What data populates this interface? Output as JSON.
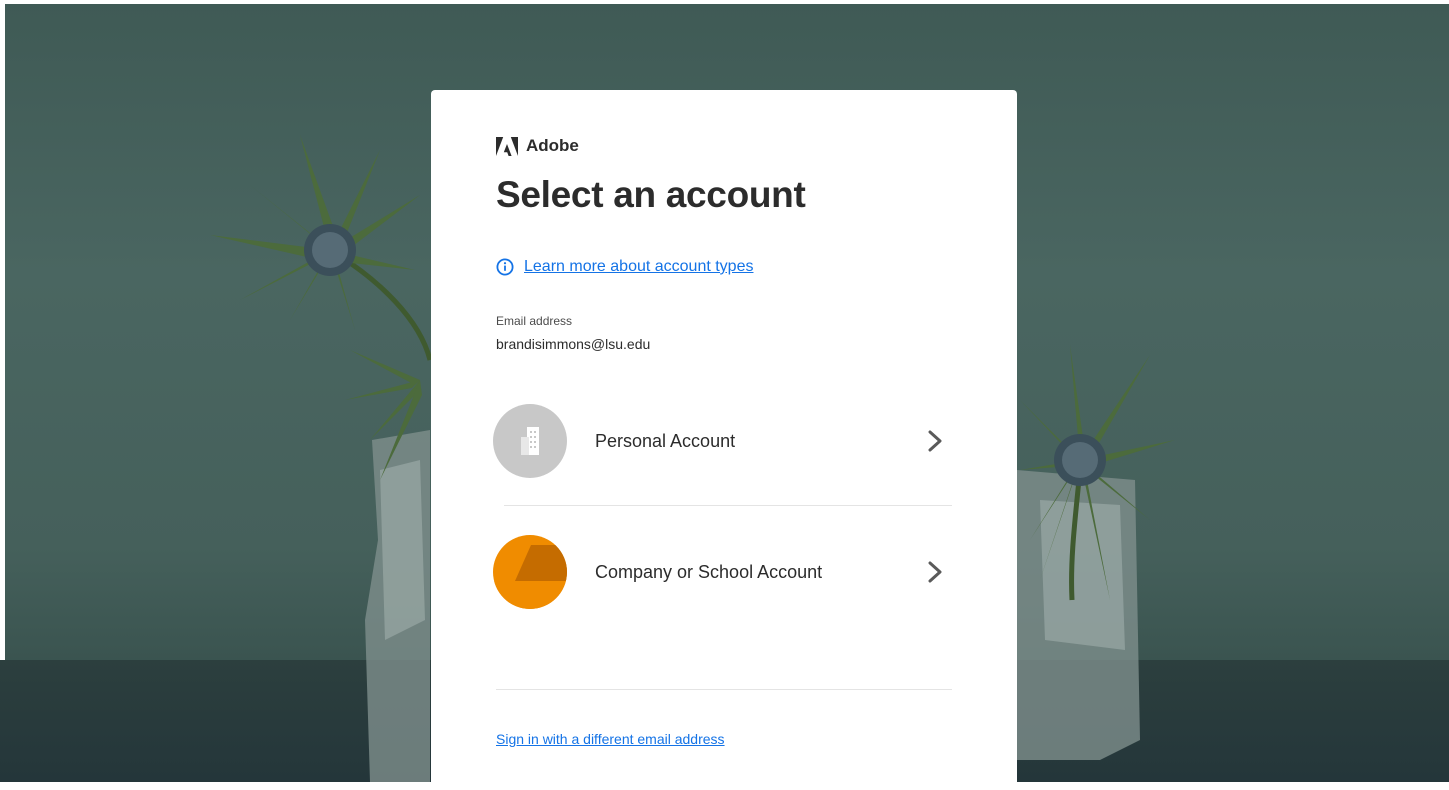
{
  "brand": {
    "name": "Adobe",
    "logo_icon": "adobe-logo-icon",
    "accent_color": "#1473e6"
  },
  "page": {
    "title": "Select an account",
    "learn_more_link": "Learn more about account types",
    "info_icon": "info-icon"
  },
  "email": {
    "label": "Email address",
    "value": "brandisimmons@lsu.edu"
  },
  "accounts": [
    {
      "label": "Personal Account",
      "avatar_icon": "building-icon",
      "avatar_color": "#c8c8c8",
      "chevron_icon": "chevron-right-icon"
    },
    {
      "label": "Company or School Account",
      "avatar_icon": "company-logo-icon",
      "avatar_color": "#f08c00",
      "chevron_icon": "chevron-right-icon"
    }
  ],
  "footer": {
    "different_email_link": "Sign in with a different email address"
  }
}
